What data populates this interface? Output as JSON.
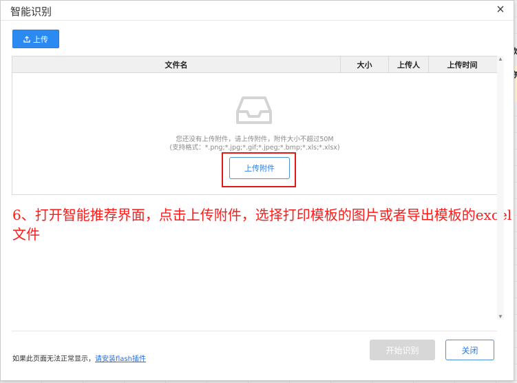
{
  "dialog": {
    "title": "智能识别",
    "close_icon": "×"
  },
  "toolbar": {
    "upload_label": "上传"
  },
  "table": {
    "columns": [
      "文件名",
      "大小",
      "上传人",
      "上传时间"
    ]
  },
  "empty_state": {
    "icon": "empty-inbox-icon",
    "line1": "您还没有上传附件，请上传附件，附件大小不超过50M",
    "line2": "(支持格式：*.png;*.jpg;*.gif;*.jpeg;*.bmp;*.xls;*.xlsx)",
    "attach_label": "上传附件"
  },
  "annotation": {
    "text": "6、打开智能推荐界面，点击上传附件，选择打印模板的图片或者导出模板的excel文件",
    "color": "#ff1a1a"
  },
  "footer": {
    "flash_tip": "如果此页面无法正常显示，",
    "flash_link": "请安装flash插件",
    "start_label": "开始识别",
    "close_label": "关闭"
  },
  "background": {
    "side_texts": [
      "款",
      "称"
    ]
  },
  "colors": {
    "primary": "#2a8af2",
    "highlight": "#e01818",
    "disabled": "#d7d7d7"
  }
}
